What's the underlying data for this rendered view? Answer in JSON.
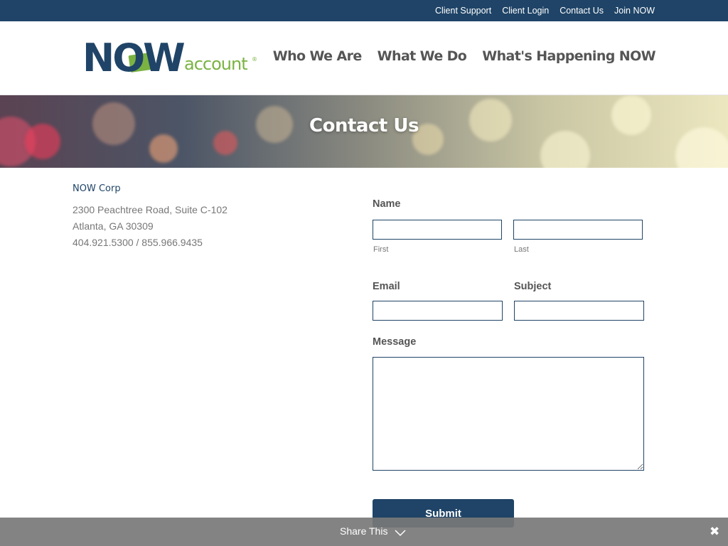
{
  "topbar": {
    "links": [
      "Client Support",
      "Client Login",
      "Contact Us",
      "Join NOW"
    ]
  },
  "logo": {
    "primary": "NOW",
    "secondary": "account",
    "mark": "®",
    "colors": {
      "navy": "#1f4467",
      "green": "#7ab342"
    }
  },
  "nav": {
    "items": [
      "Who We Are",
      "What We Do",
      "What's Happening NOW"
    ]
  },
  "hero": {
    "title": "Contact Us"
  },
  "address": {
    "company": "NOW Corp",
    "street": "2300 Peachtree Road, Suite C-102",
    "city": "Atlanta, GA 30309",
    "phone": "404.921.5300 / 855.966.9435"
  },
  "form": {
    "name_label": "Name",
    "first_sublabel": "First",
    "last_sublabel": "Last",
    "first_value": "",
    "last_value": "",
    "email_label": "Email",
    "email_value": "",
    "subject_label": "Subject",
    "subject_value": "",
    "message_label": "Message",
    "message_value": "",
    "submit_label": "Submit"
  },
  "share": {
    "label": "Share This",
    "icons": [
      "chevron-down-icon",
      "close-icon"
    ]
  },
  "colors": {
    "brand_navy": "#1f4467",
    "brand_green": "#7ab342",
    "text": "#555555",
    "share_bar": "#787878"
  }
}
